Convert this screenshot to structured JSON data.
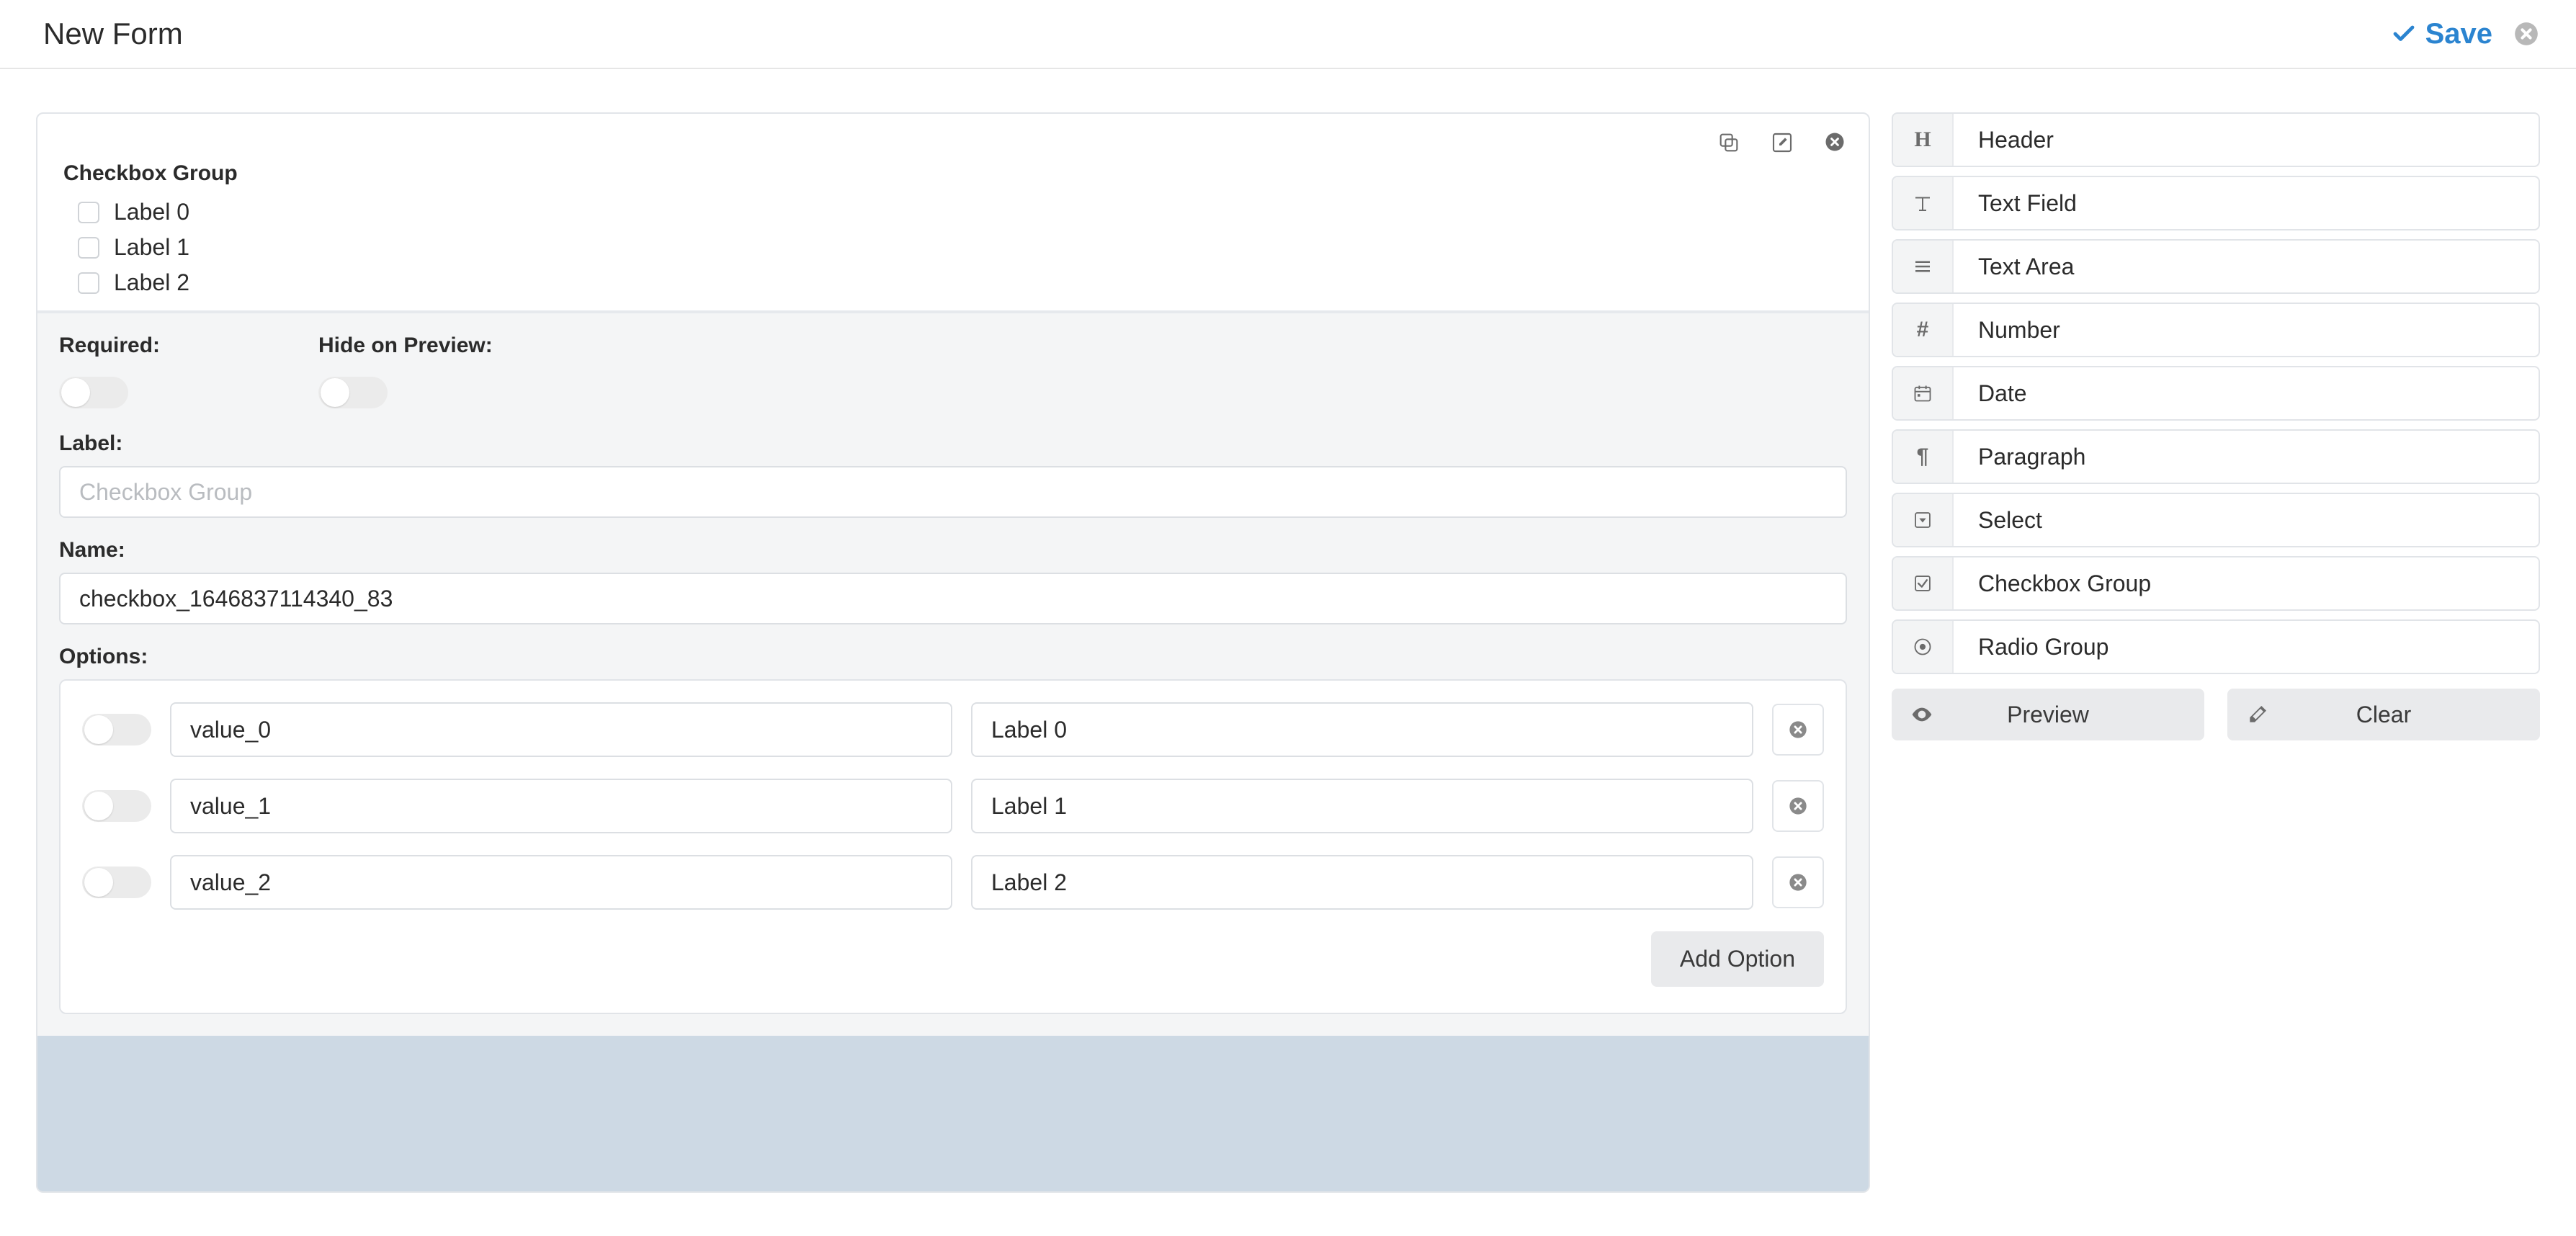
{
  "top": {
    "title": "New Form",
    "save_label": "Save"
  },
  "card": {
    "section_label": "Checkbox Group",
    "checks": [
      "Label 0",
      "Label 1",
      "Label 2"
    ]
  },
  "settings": {
    "required_label": "Required:",
    "hide_label": "Hide on Preview:",
    "label_caption": "Label:",
    "label_placeholder": "Checkbox Group",
    "label_value": "",
    "name_caption": "Name:",
    "name_value": "checkbox_1646837114340_83",
    "options_caption": "Options:",
    "options": [
      {
        "value": "value_0",
        "label": "Label 0"
      },
      {
        "value": "value_1",
        "label": "Label 1"
      },
      {
        "value": "value_2",
        "label": "Label 2"
      }
    ],
    "add_option_label": "Add Option"
  },
  "palette": {
    "items": [
      {
        "key": "header",
        "label": "Header"
      },
      {
        "key": "text-field",
        "label": "Text Field"
      },
      {
        "key": "text-area",
        "label": "Text Area"
      },
      {
        "key": "number",
        "label": "Number"
      },
      {
        "key": "date",
        "label": "Date"
      },
      {
        "key": "paragraph",
        "label": "Paragraph"
      },
      {
        "key": "select",
        "label": "Select"
      },
      {
        "key": "checkbox-group",
        "label": "Checkbox Group"
      },
      {
        "key": "radio-group",
        "label": "Radio Group"
      }
    ],
    "preview_label": "Preview",
    "clear_label": "Clear"
  },
  "icons": {
    "check": "check-icon",
    "close": "close-circle-icon",
    "copy": "copy-icon",
    "edit": "edit-icon",
    "remove": "remove-circle-icon",
    "eye": "eye-icon",
    "eraser": "eraser-icon"
  }
}
